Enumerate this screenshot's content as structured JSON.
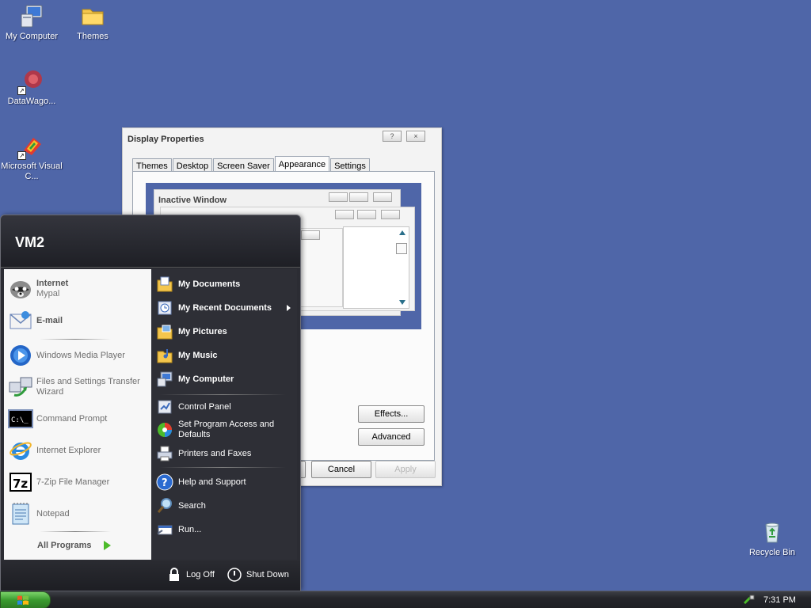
{
  "desktop": {
    "icons": [
      {
        "label": "My Computer",
        "icon": "my-computer-icon"
      },
      {
        "label": "Themes",
        "icon": "folder-icon"
      },
      {
        "label": "DataWago...",
        "icon": "datawagon-icon"
      },
      {
        "label": "Microsoft Visual C...",
        "icon": "visual-c-icon"
      },
      {
        "label": "Recycle Bin",
        "icon": "recycle-bin-icon"
      }
    ],
    "background_color": "#4f66a8"
  },
  "dialog": {
    "title": "Display Properties",
    "help_glyph": "?",
    "close_glyph": "×",
    "tabs": [
      "Themes",
      "Desktop",
      "Screen Saver",
      "Appearance",
      "Settings"
    ],
    "active_tab": "Appearance",
    "preview": {
      "inactive_window_title": "Inactive Window"
    },
    "buttons": {
      "effects": "Effects...",
      "advanced": "Advanced",
      "cancel": "Cancel",
      "apply": "Apply"
    }
  },
  "start_menu": {
    "user": "VM2",
    "pinned": [
      {
        "title": "Internet",
        "subtitle": "Mypal",
        "icon": "mypal-raccoon-icon"
      },
      {
        "title": "E-mail",
        "subtitle": "",
        "icon": "email-icon"
      }
    ],
    "recent": [
      {
        "label": "Windows Media Player",
        "icon": "media-player-icon"
      },
      {
        "label": "Files and Settings Transfer Wizard",
        "icon": "transfer-wizard-icon"
      },
      {
        "label": "Command Prompt",
        "icon": "command-prompt-icon"
      },
      {
        "label": "Internet Explorer",
        "icon": "internet-explorer-icon"
      },
      {
        "label": "7-Zip File Manager",
        "icon": "7zip-icon"
      },
      {
        "label": "Notepad",
        "icon": "notepad-icon"
      }
    ],
    "all_programs": "All Programs",
    "places": [
      {
        "label": "My Documents",
        "icon": "documents-folder-icon",
        "bold": true
      },
      {
        "label": "My Recent Documents",
        "icon": "recent-documents-icon",
        "bold": true,
        "submenu": true
      },
      {
        "label": "My Pictures",
        "icon": "pictures-folder-icon",
        "bold": true
      },
      {
        "label": "My Music",
        "icon": "music-folder-icon",
        "bold": true
      },
      {
        "label": "My Computer",
        "icon": "computer-icon",
        "bold": true
      }
    ],
    "system": [
      {
        "label": "Control Panel",
        "icon": "control-panel-icon"
      },
      {
        "label": "Set Program Access and Defaults",
        "icon": "program-defaults-icon"
      },
      {
        "label": "Printers and Faxes",
        "icon": "printer-icon"
      }
    ],
    "help": [
      {
        "label": "Help and Support",
        "icon": "help-icon"
      },
      {
        "label": "Search",
        "icon": "search-icon"
      },
      {
        "label": "Run...",
        "icon": "run-icon"
      }
    ],
    "log_off": "Log Off",
    "shut_down": "Shut Down"
  },
  "taskbar": {
    "clock": "7:31 PM"
  }
}
